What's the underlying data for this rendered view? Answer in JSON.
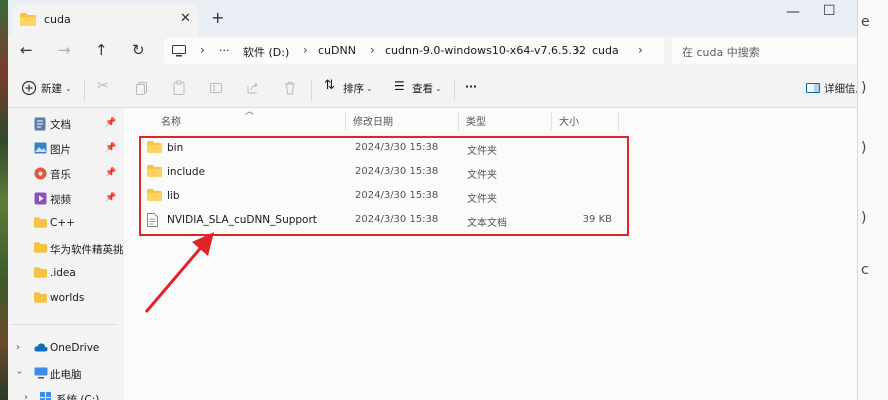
{
  "window": {
    "tab_title": "cuda"
  },
  "address": {
    "crumbs": [
      "软件 (D:)",
      "cuDNN",
      "cudnn-9.0-windows10-x64-v7.6.5.32",
      "cuda"
    ],
    "ellipsis": "···",
    "search_placeholder": "在 cuda 中搜索"
  },
  "commandbar": {
    "new_label": "新建",
    "sort_label": "排序",
    "view_label": "查看",
    "more_label": "···",
    "details_label": "详细信息"
  },
  "navpane": {
    "items": [
      {
        "label": "文档",
        "icon": "document-icon",
        "pinned": true
      },
      {
        "label": "图片",
        "icon": "pictures-icon",
        "pinned": true
      },
      {
        "label": "音乐",
        "icon": "music-icon",
        "pinned": true
      },
      {
        "label": "视频",
        "icon": "video-icon",
        "pinned": true
      },
      {
        "label": "C++",
        "icon": "folder-icon",
        "pinned": false
      },
      {
        "label": "华为软件精英挑",
        "icon": "folder-icon",
        "pinned": false
      },
      {
        "label": ".idea",
        "icon": "folder-icon",
        "pinned": false
      },
      {
        "label": "worlds",
        "icon": "folder-icon",
        "pinned": false
      }
    ],
    "onedrive": "OneDrive",
    "thispc": "此电脑",
    "system": "系统 (C:)"
  },
  "filelist": {
    "columns": {
      "name": "名称",
      "modified": "修改日期",
      "type": "类型",
      "size": "大小"
    },
    "rows": [
      {
        "name": "bin",
        "modified": "2024/3/30 15:38",
        "type": "文件夹",
        "size": "",
        "icon": "folder-icon"
      },
      {
        "name": "include",
        "modified": "2024/3/30 15:38",
        "type": "文件夹",
        "size": "",
        "icon": "folder-icon"
      },
      {
        "name": "lib",
        "modified": "2024/3/30 15:38",
        "type": "文件夹",
        "size": "",
        "icon": "folder-icon"
      },
      {
        "name": "NVIDIA_SLA_cuDNN_Support",
        "modified": "2024/3/30 15:38",
        "type": "文本文档",
        "size": "39 KB",
        "icon": "text-file-icon"
      }
    ]
  },
  "colors": {
    "highlight": "#e0252a",
    "folder": "#f5c342",
    "accent": "#0067c0"
  }
}
